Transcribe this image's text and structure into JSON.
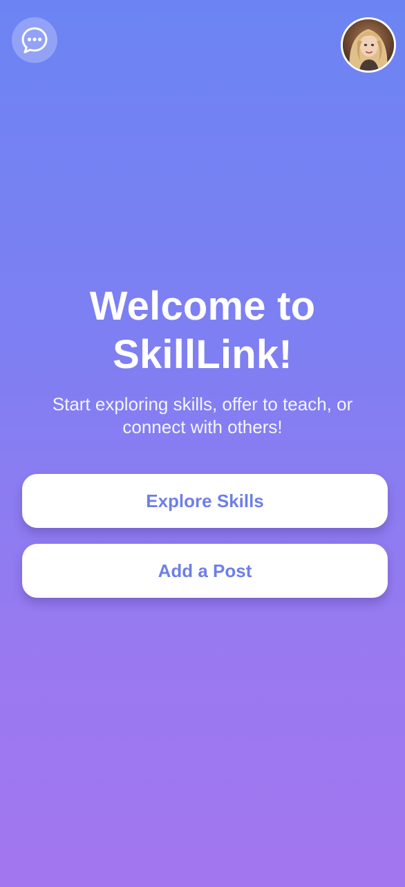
{
  "header": {
    "chat_icon": "chat-bubble-ellipsis-icon",
    "avatar": "user-avatar-photo"
  },
  "hero": {
    "title": "Welcome to SkillLink!",
    "subtitle": "Start exploring skills, offer to teach, or connect with others!"
  },
  "actions": {
    "explore_label": "Explore Skills",
    "post_label": "Add a Post"
  },
  "colors": {
    "gradient_top": "#6c84f3",
    "gradient_bottom": "#a276ef",
    "button_text": "#6d7fe6",
    "button_bg": "#ffffff"
  }
}
